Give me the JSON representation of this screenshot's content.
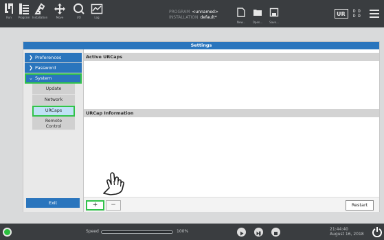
{
  "header": {
    "nav_items": [
      {
        "label": "Run",
        "icon": "ur-logo-icon"
      },
      {
        "label": "Program",
        "icon": "program-icon"
      },
      {
        "label": "Installation",
        "icon": "installation-icon"
      },
      {
        "label": "Move",
        "icon": "move-icon"
      },
      {
        "label": "I/O",
        "icon": "io-icon"
      },
      {
        "label": "Log",
        "icon": "log-icon"
      }
    ],
    "program_label": "PROGRAM",
    "program_value": "<unnamed>",
    "installation_label": "INSTALLATION",
    "installation_value": "default*",
    "file_buttons": [
      {
        "label": "New...",
        "icon": "new-file-icon"
      },
      {
        "label": "Open...",
        "icon": "open-folder-icon"
      },
      {
        "label": "Save...",
        "icon": "save-icon"
      }
    ],
    "mode_indicator": "D D\nD D"
  },
  "settings": {
    "title": "Settings",
    "sidebar": {
      "items": [
        {
          "label": "Preferences",
          "expanded": false
        },
        {
          "label": "Password",
          "expanded": false
        },
        {
          "label": "System",
          "expanded": true
        }
      ],
      "sub_items": [
        "Update",
        "Network",
        "URCaps",
        "Remote Control"
      ],
      "active_sub_item": "URCaps",
      "exit_label": "Exit"
    },
    "sections": {
      "active_urcaps": "Active URCaps",
      "urcap_information": "URCap Information"
    },
    "buttons": {
      "add_label": "+",
      "remove_label": "−",
      "restart_label": "Restart"
    }
  },
  "footer": {
    "speed_label": "Speed",
    "speed_value": "100%",
    "speed_fraction": 1.0,
    "time": "21:44:40",
    "date": "August 16, 2018"
  },
  "colors": {
    "accent_blue": "#2a75bd",
    "highlight_green": "#31c24a",
    "header_bg": "#3a3d40"
  }
}
